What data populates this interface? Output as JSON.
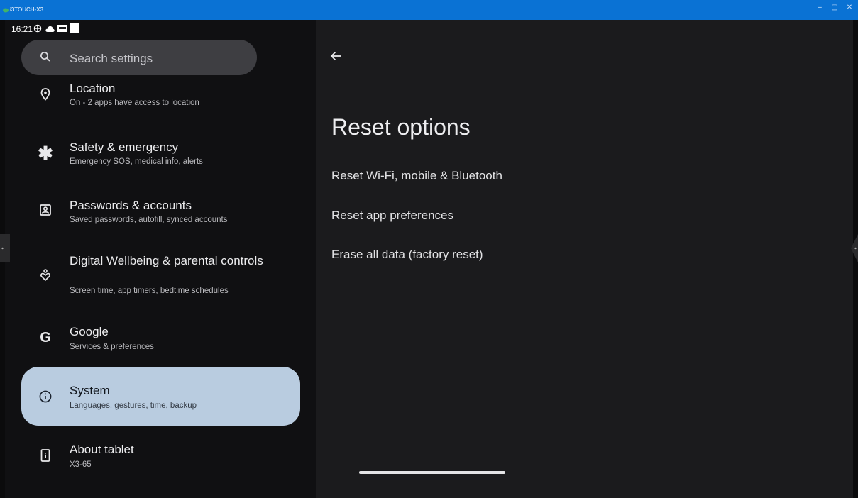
{
  "window": {
    "title": "i3TOUCH-X3"
  },
  "statusbar": {
    "time": "16:21"
  },
  "search": {
    "placeholder": "Search settings"
  },
  "settings_items": [
    {
      "title": "Location",
      "subtitle": "On - 2 apps have access to location",
      "icon": "location-icon"
    },
    {
      "title": "Safety & emergency",
      "subtitle": "Emergency SOS, medical info, alerts",
      "icon": "asterisk-icon"
    },
    {
      "title": "Passwords & accounts",
      "subtitle": "Saved passwords, autofill, synced accounts",
      "icon": "account-box-icon"
    },
    {
      "title": "Digital Wellbeing & parental controls",
      "subtitle": "Screen time, app timers, bedtime schedules",
      "icon": "wellbeing-icon"
    },
    {
      "title": "Google",
      "subtitle": "Services & preferences",
      "icon": "google-icon"
    },
    {
      "title": "System",
      "subtitle": "Languages, gestures, time, backup",
      "icon": "info-icon"
    },
    {
      "title": "About tablet",
      "subtitle": "X3-65",
      "icon": "tablet-icon"
    }
  ],
  "detail": {
    "title": "Reset options",
    "options": [
      "Reset Wi-Fi, mobile & Bluetooth",
      "Reset app preferences",
      "Erase all data (factory reset)"
    ]
  },
  "colors": {
    "titlebar": "#0a72d4",
    "selected_item": "#b9cce0",
    "left_pane": "#101012",
    "right_pane": "#1b1b1d"
  }
}
